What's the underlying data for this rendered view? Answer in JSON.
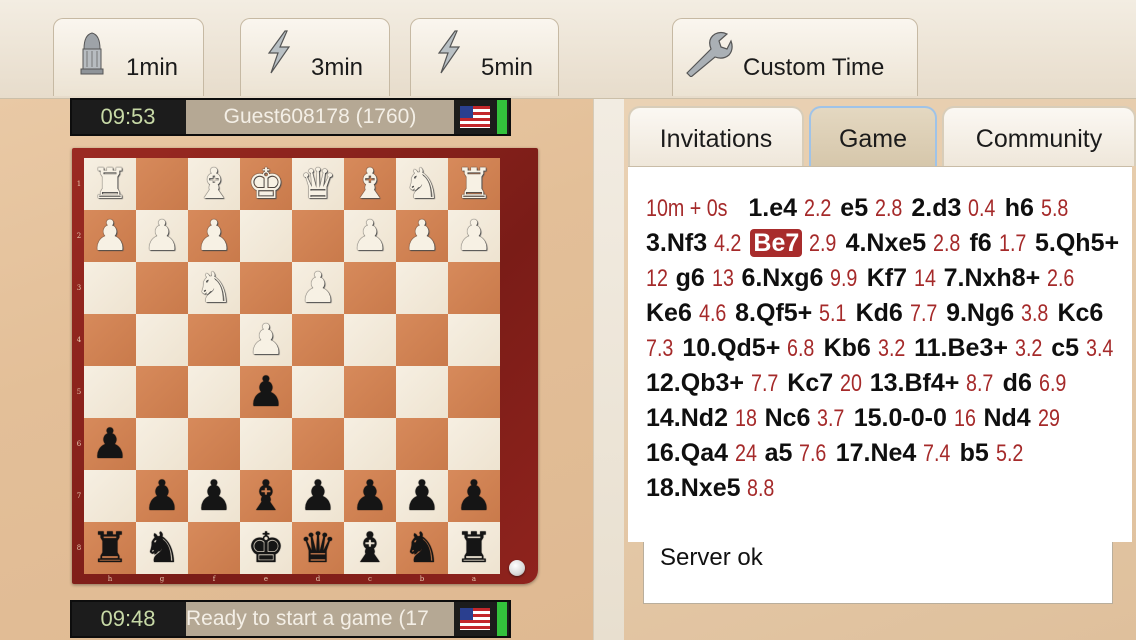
{
  "toolbar": {
    "buttons": [
      {
        "label": "1min",
        "icon": "bullet-icon"
      },
      {
        "label": "3min",
        "icon": "lightning-icon"
      },
      {
        "label": "5min",
        "icon": "lightning-icon"
      },
      {
        "label": "Custom Time",
        "icon": "wrench-icon"
      }
    ]
  },
  "top_player": {
    "clock": "09:53",
    "name": "Guest608178 (1760)",
    "flag": "us-flag-icon",
    "indicator_color": "#33c23c"
  },
  "bottom_player": {
    "clock": "09:48",
    "name": "Ready to start a game (17",
    "flag": "us-flag-icon",
    "indicator_color": "#33c23c"
  },
  "board": {
    "orientation": "black-bottom",
    "rank_labels": [
      "1",
      "2",
      "3",
      "4",
      "5",
      "6",
      "7",
      "8"
    ],
    "file_labels": [
      "h",
      "g",
      "f",
      "e",
      "d",
      "c",
      "b",
      "a"
    ],
    "rows": [
      [
        "wR",
        "",
        "wB",
        "wK",
        "wQ",
        "wB",
        "wN",
        "wR"
      ],
      [
        "wP",
        "wP",
        "wP",
        "",
        "",
        "wP",
        "wP",
        "wP"
      ],
      [
        "",
        "",
        "wN",
        "",
        "wP",
        "",
        "",
        ""
      ],
      [
        "",
        "",
        "",
        "wP",
        "",
        "",
        "",
        ""
      ],
      [
        "",
        "",
        "",
        "bP",
        "",
        "",
        "",
        ""
      ],
      [
        "bP",
        "",
        "",
        "",
        "",
        "",
        "",
        ""
      ],
      [
        "",
        "bP",
        "bP",
        "bB",
        "bP",
        "bP",
        "bP",
        "bP"
      ],
      [
        "bR",
        "bN",
        "",
        "bK",
        "bQ",
        "bB",
        "bN",
        "bR"
      ]
    ]
  },
  "tabs": [
    {
      "label": "Invitations",
      "active": false
    },
    {
      "label": "Game",
      "active": true
    },
    {
      "label": "Community",
      "active": false
    }
  ],
  "moves": {
    "header_time": "10m + 0s",
    "tokens": [
      {
        "t": "mv",
        "v": "1.e4"
      },
      {
        "t": "tm",
        "v": "2.2"
      },
      {
        "t": "mv",
        "v": "e5"
      },
      {
        "t": "tm",
        "v": "2.8"
      },
      {
        "t": "mv",
        "v": "2.d3"
      },
      {
        "t": "tm",
        "v": "0.4"
      },
      {
        "t": "mv",
        "v": "h6"
      },
      {
        "t": "tm",
        "v": "5.8"
      },
      {
        "t": "mv",
        "v": "3.Nf3"
      },
      {
        "t": "tm",
        "v": "4.2"
      },
      {
        "t": "hl",
        "v": "Be7"
      },
      {
        "t": "tm",
        "v": "2.9"
      },
      {
        "t": "mv",
        "v": "4.Nxe5"
      },
      {
        "t": "tm",
        "v": "2.8"
      },
      {
        "t": "mv",
        "v": "f6"
      },
      {
        "t": "tm",
        "v": "1.7"
      },
      {
        "t": "mv",
        "v": "5.Qh5+"
      },
      {
        "t": "tm",
        "v": "12"
      },
      {
        "t": "mv",
        "v": "g6"
      },
      {
        "t": "tm",
        "v": "13"
      },
      {
        "t": "mv",
        "v": "6.Nxg6"
      },
      {
        "t": "tm",
        "v": "9.9"
      },
      {
        "t": "mv",
        "v": "Kf7"
      },
      {
        "t": "tm",
        "v": "14"
      },
      {
        "t": "mv",
        "v": "7.Nxh8+"
      },
      {
        "t": "tm",
        "v": "2.6"
      },
      {
        "t": "mv",
        "v": "Ke6"
      },
      {
        "t": "tm",
        "v": "4.6"
      },
      {
        "t": "mv",
        "v": "8.Qf5+"
      },
      {
        "t": "tm",
        "v": "5.1"
      },
      {
        "t": "mv",
        "v": "Kd6"
      },
      {
        "t": "tm",
        "v": "7.7"
      },
      {
        "t": "mv",
        "v": "9.Ng6"
      },
      {
        "t": "tm",
        "v": "3.8"
      },
      {
        "t": "mv",
        "v": "Kc6"
      },
      {
        "t": "tm",
        "v": "7.3"
      },
      {
        "t": "mv",
        "v": "10.Qd5+"
      },
      {
        "t": "tm",
        "v": "6.8"
      },
      {
        "t": "mv",
        "v": "Kb6"
      },
      {
        "t": "tm",
        "v": "3.2"
      },
      {
        "t": "mv",
        "v": "11.Be3+"
      },
      {
        "t": "tm",
        "v": "3.2"
      },
      {
        "t": "mv",
        "v": "c5"
      },
      {
        "t": "tm",
        "v": "3.4"
      },
      {
        "t": "mv",
        "v": "12.Qb3+"
      },
      {
        "t": "tm",
        "v": "7.7"
      },
      {
        "t": "mv",
        "v": "Kc7"
      },
      {
        "t": "tm",
        "v": "20"
      },
      {
        "t": "mv",
        "v": "13.Bf4+"
      },
      {
        "t": "tm",
        "v": "8.7"
      },
      {
        "t": "mv",
        "v": "d6"
      },
      {
        "t": "tm",
        "v": "6.9"
      },
      {
        "t": "mv",
        "v": "14.Nd2"
      },
      {
        "t": "tm",
        "v": "18"
      },
      {
        "t": "mv",
        "v": "Nc6"
      },
      {
        "t": "tm",
        "v": "3.7"
      },
      {
        "t": "mv",
        "v": "15.0-0-0"
      },
      {
        "t": "tm",
        "v": "16"
      },
      {
        "t": "mv",
        "v": "Nd4"
      },
      {
        "t": "tm",
        "v": "29"
      },
      {
        "t": "mv",
        "v": "16.Qa4"
      },
      {
        "t": "tm",
        "v": "24"
      },
      {
        "t": "mv",
        "v": "a5"
      },
      {
        "t": "tm",
        "v": "7.6"
      },
      {
        "t": "mv",
        "v": "17.Ne4"
      },
      {
        "t": "tm",
        "v": "7.4"
      },
      {
        "t": "mv",
        "v": "b5"
      },
      {
        "t": "tm",
        "v": "5.2"
      },
      {
        "t": "mv",
        "v": "18.Nxe5"
      },
      {
        "t": "tm",
        "v": "8.8"
      }
    ]
  },
  "status": {
    "text": "Server ok"
  },
  "colors": {
    "time_red": "#a52a2a",
    "highlight": "#a82c2c",
    "clock_green_text": "#c7d9a6",
    "board_frame": "#8f231d"
  }
}
